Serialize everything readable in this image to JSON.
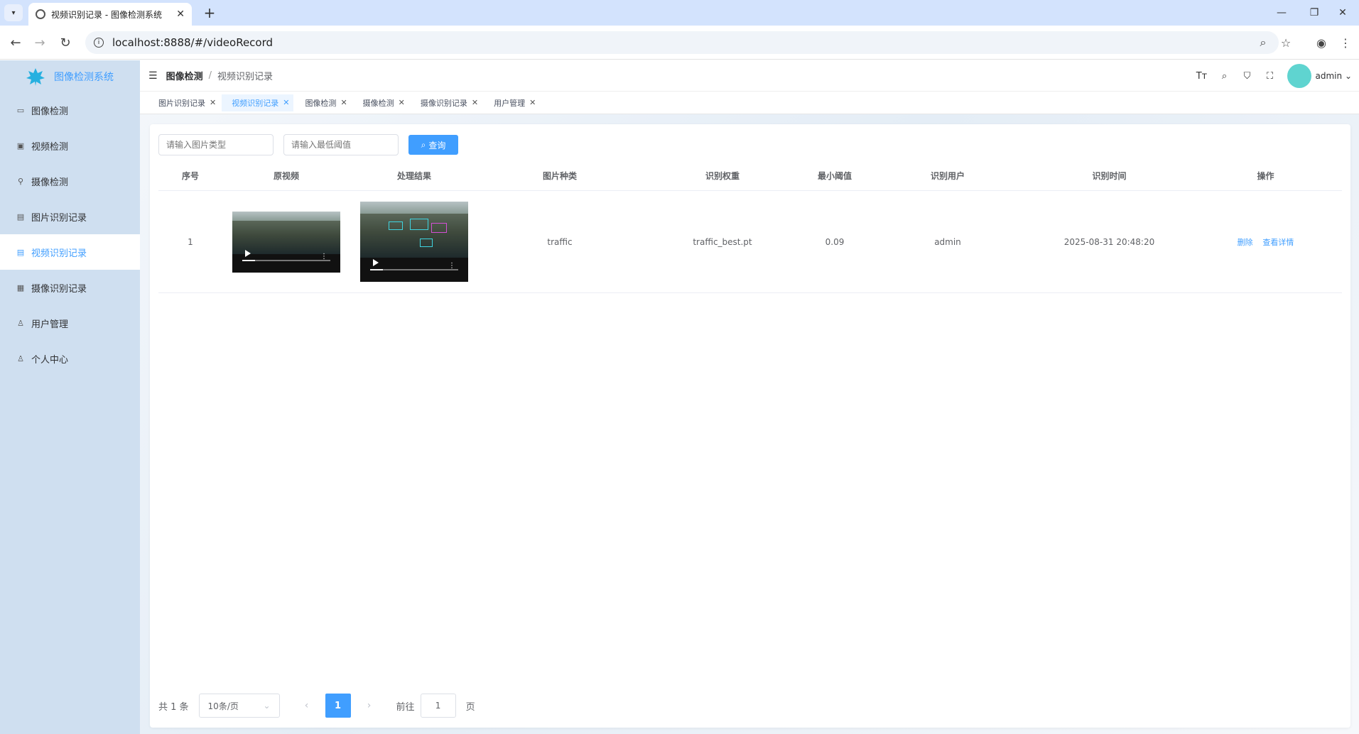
{
  "browser": {
    "tab_title": "视频识别记录 - 图像检测系统",
    "url": "localhost:8888/#/videoRecord"
  },
  "app": {
    "logo_text": "图像检测系统",
    "brand_color": "#409eff"
  },
  "sidebar": {
    "items": [
      {
        "label": "图像检测",
        "icon": "image-icon"
      },
      {
        "label": "视频检测",
        "icon": "video-icon"
      },
      {
        "label": "摄像检测",
        "icon": "camera-icon"
      },
      {
        "label": "图片识别记录",
        "icon": "document-icon"
      },
      {
        "label": "视频识别记录",
        "icon": "document-icon",
        "active": true
      },
      {
        "label": "摄像识别记录",
        "icon": "film-icon"
      },
      {
        "label": "用户管理",
        "icon": "user-icon"
      },
      {
        "label": "个人中心",
        "icon": "user-circle-icon"
      }
    ]
  },
  "header": {
    "breadcrumb_root": "图像检测",
    "breadcrumb_current": "视频识别记录",
    "user": "admin"
  },
  "tags": [
    {
      "label": "图片识别记录"
    },
    {
      "label": "视频识别记录",
      "active": true
    },
    {
      "label": "图像检测"
    },
    {
      "label": "摄像检测"
    },
    {
      "label": "摄像识别记录"
    },
    {
      "label": "用户管理"
    }
  ],
  "filters": {
    "type_placeholder": "请输入图片类型",
    "threshold_placeholder": "请输入最低阈值",
    "query_label": "查询"
  },
  "table": {
    "headers": [
      "序号",
      "原视频",
      "处理结果",
      "图片种类",
      "识别权重",
      "最小阈值",
      "识别用户",
      "识别时间",
      "操作"
    ],
    "rows": [
      {
        "index": "1",
        "kind": "traffic",
        "weight": "traffic_best.pt",
        "threshold": "0.09",
        "user": "admin",
        "time": "2025-08-31 20:48:20",
        "delete_label": "删除",
        "detail_label": "查看详情"
      }
    ]
  },
  "pagination": {
    "total": "共 1 条",
    "page_size": "10条/页",
    "current_page": "1",
    "goto_label": "前往",
    "goto_value": "1",
    "page_word": "页"
  }
}
